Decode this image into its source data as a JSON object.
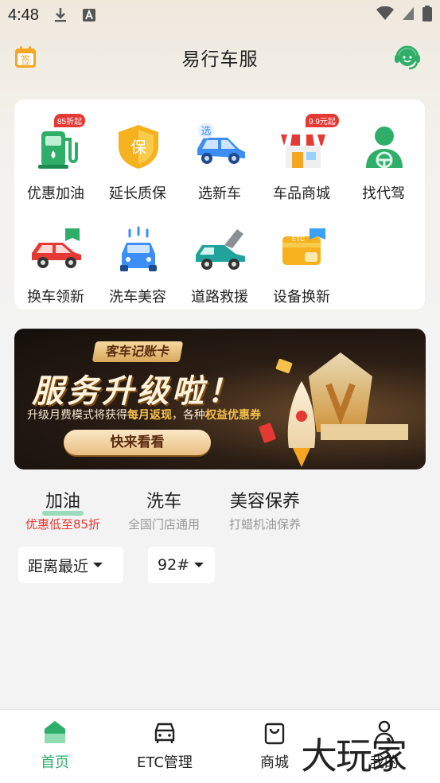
{
  "status_bar": {
    "time": "4:48"
  },
  "header": {
    "title": "易行车服",
    "sign_icon_text": "签"
  },
  "services": [
    {
      "label": "优惠加油",
      "icon": "gas-pump-icon",
      "badge": "85折起"
    },
    {
      "label": "延长质保",
      "icon": "shield-icon",
      "icon_text": "保"
    },
    {
      "label": "选新车",
      "icon": "blue-car-icon",
      "icon_text": "选"
    },
    {
      "label": "车品商城",
      "icon": "store-icon",
      "badge": "9.9元起"
    },
    {
      "label": "找代驾",
      "icon": "driver-icon"
    },
    {
      "label": "换车领新",
      "icon": "red-car-icon"
    },
    {
      "label": "洗车美容",
      "icon": "car-wash-icon"
    },
    {
      "label": "道路救援",
      "icon": "rescue-car-icon"
    },
    {
      "label": "设备换新",
      "icon": "etc-card-icon",
      "icon_text": "ETC"
    }
  ],
  "banner": {
    "tag": "客车记账卡",
    "headline": "服务升级啦！",
    "sub_prefix": "升级月费模式将获得",
    "sub_highlight1": "每月返现",
    "sub_middle": "，各种",
    "sub_highlight2": "权益优惠券",
    "cta": "快来看看"
  },
  "category_tabs": [
    {
      "title": "加油",
      "subtitle": "优惠低至85折",
      "active": true
    },
    {
      "title": "洗车",
      "subtitle": "全国门店通用",
      "active": false
    },
    {
      "title": "美容保养",
      "subtitle": "打蜡机油保养",
      "active": false
    }
  ],
  "filters": {
    "distance": "距离最近",
    "fuel": "92#"
  },
  "bottom_nav": [
    {
      "label": "首页",
      "icon": "home-icon",
      "active": true
    },
    {
      "label": "ETC管理",
      "icon": "car-front-icon",
      "active": false
    },
    {
      "label": "商城",
      "icon": "shopping-bag-icon",
      "active": false
    },
    {
      "label": "我的",
      "icon": "user-icon",
      "active": false
    }
  ],
  "watermark": "大玩家",
  "colors": {
    "accent": "#2fae6a",
    "discount": "#e53935",
    "banner_gold": "#f6c04a"
  }
}
